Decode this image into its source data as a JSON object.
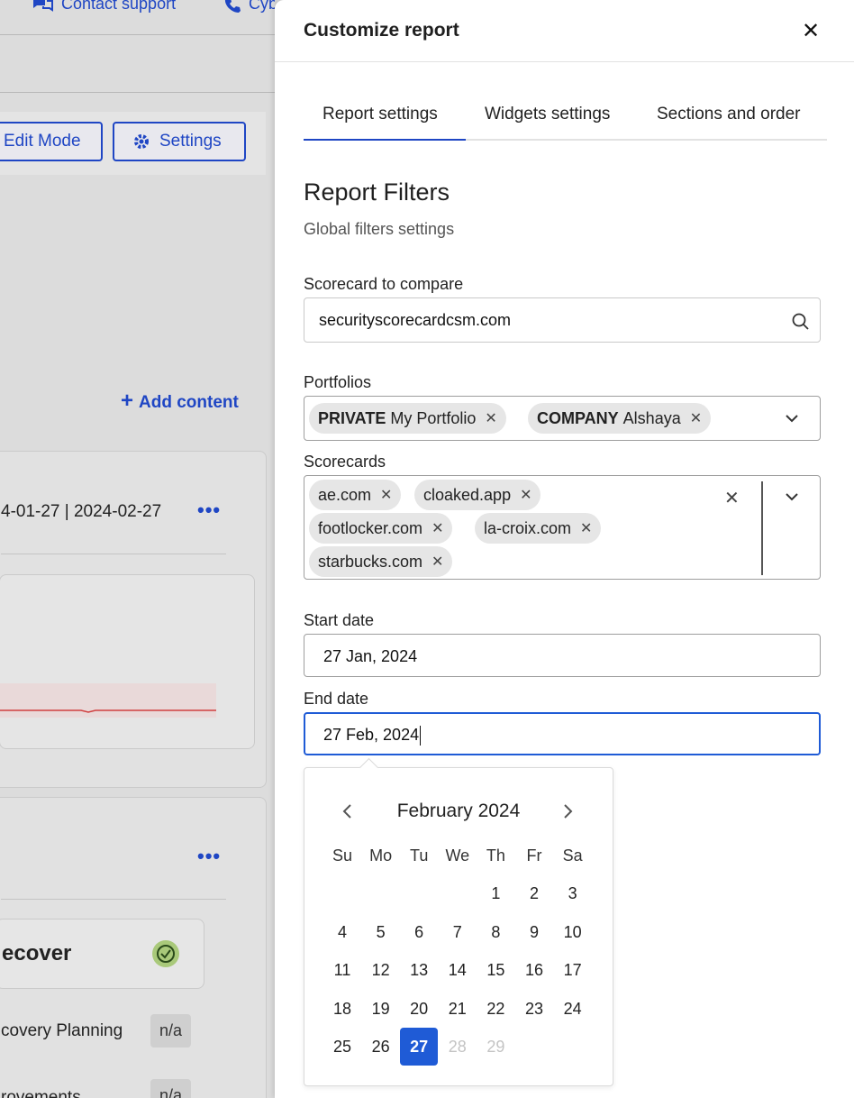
{
  "background": {
    "topbar": {
      "contact_support": "Contact support",
      "cyber_label": "CyberM"
    },
    "toolbar": {
      "edit_mode": "Edit Mode",
      "settings": "Settings"
    },
    "add_content": "Add content",
    "date_range": "4-01-27 | 2024-02-27",
    "recover_card": {
      "title": "ecover",
      "row1_label": "covery Planning",
      "row1_value": "n/a",
      "row2_label": "rovements",
      "row2_value": "n/a"
    }
  },
  "panel": {
    "title": "Customize report",
    "tabs": [
      {
        "label": "Report settings",
        "active": true
      },
      {
        "label": "Widgets settings",
        "active": false
      },
      {
        "label": "Sections and order",
        "active": false
      }
    ],
    "section_title": "Report Filters",
    "section_subtitle": "Global filters settings",
    "scorecard_compare": {
      "label": "Scorecard to compare",
      "value": "securityscorecardcsm.com"
    },
    "portfolios": {
      "label": "Portfolios",
      "chips": [
        {
          "prefix": "PRIVATE",
          "name": "My Portfolio"
        },
        {
          "prefix": "COMPANY",
          "name": "Alshaya"
        }
      ]
    },
    "scorecards": {
      "label": "Scorecards",
      "chips": [
        "ae.com",
        "cloaked.app",
        "footlocker.com",
        "la-croix.com",
        "starbucks.com"
      ]
    },
    "start_date": {
      "label": "Start date",
      "value": "27 Jan, 2024"
    },
    "end_date": {
      "label": "End date",
      "value": "27 Feb, 2024"
    },
    "calendar": {
      "month": "February 2024",
      "weekdays": [
        "Su",
        "Mo",
        "Tu",
        "We",
        "Th",
        "Fr",
        "Sa"
      ],
      "first_weekday_index": 4,
      "days_in_month": 29,
      "selected_day": 27,
      "disabled_from": 28
    }
  },
  "colors": {
    "accent": "#1f46c4",
    "selected": "#1f5bd6"
  }
}
